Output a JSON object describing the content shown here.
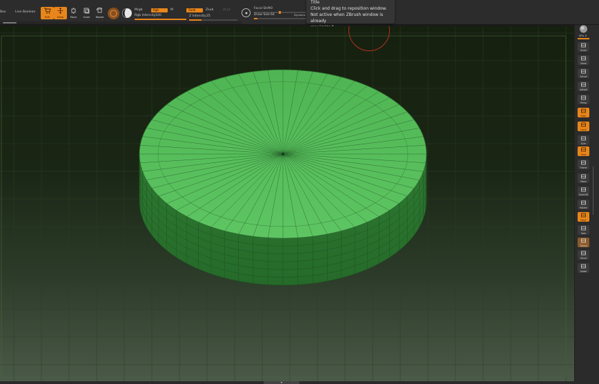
{
  "toolbar": {
    "lightbox_label": "Box",
    "live_boolean_label": "Live Boolean",
    "edit_label": "Edit",
    "draw_label": "Draw",
    "move_label": "Move",
    "scale_label": "Scale",
    "rotate_label": "Rotate",
    "mrgb_label": "Mrgb",
    "rgb_label": "Rgb",
    "m_label": "M",
    "rgb_intensity_label": "Rgb Intensity",
    "rgb_intensity_value": "100",
    "zadd_label": "Zadd",
    "zsub_label": "Zsub",
    "zcut_label": "Zcut",
    "z_intensity_label": "Z Intensity",
    "z_intensity_value": "25",
    "focal_shift_label": "Focal Shift",
    "focal_shift_value": "0",
    "draw_size_label": "Draw Size",
    "draw_size_value": "64",
    "dynamic_label": "Dynamic",
    "rgb_intensity_fraction": 1.0,
    "z_intensity_fraction": 0.25,
    "draw_size_fraction": 0.06,
    "accent_color": "#e9861b"
  },
  "tooltip": {
    "title": "Title",
    "line1": "Click and drag to reposition window.",
    "line2": "Not active when ZBrush window is already",
    "line3": "maximized."
  },
  "shelf": {
    "spix_label": "SPix",
    "spix_value": "0",
    "items": [
      {
        "label": "Scroll",
        "icon": "scroll-icon",
        "state": "off"
      },
      {
        "label": "Zoom",
        "icon": "zoom-icon",
        "state": "off"
      },
      {
        "label": "Actual",
        "icon": "actual-icon",
        "state": "off"
      },
      {
        "label": "AAHalf",
        "icon": "aahalf-icon",
        "state": "off"
      },
      {
        "label": "Persp",
        "icon": "persp-icon",
        "state": "off"
      },
      {
        "label": "Floor",
        "icon": "floor-icon",
        "state": "on"
      },
      {
        "label": "Local",
        "icon": "local-icon",
        "state": "on"
      },
      {
        "label": "Sym",
        "icon": "symmetry-icon",
        "state": "off"
      },
      {
        "label": "Gxyz",
        "icon": "axis-icon",
        "state": "on"
      },
      {
        "label": "Frame",
        "icon": "frame-icon",
        "state": "off"
      },
      {
        "label": "Move",
        "icon": "move-icon",
        "state": "off"
      },
      {
        "label": "Zoom3D",
        "icon": "zoom3d-icon",
        "state": "off"
      },
      {
        "label": "Rotate",
        "icon": "rotate-icon",
        "state": "off"
      },
      {
        "label": "PolyF",
        "icon": "polyframe-icon",
        "state": "on"
      },
      {
        "label": "Solo",
        "icon": "solo-icon",
        "state": "off"
      },
      {
        "label": "Transp",
        "icon": "transp-icon",
        "state": "brown"
      },
      {
        "label": "Ghost",
        "icon": "ghost-icon",
        "state": "off"
      },
      {
        "label": "Xpose",
        "icon": "xpose-icon",
        "state": "off"
      }
    ]
  },
  "canvas": {
    "model_color": "#4caf50",
    "background_top": "#16200f",
    "background_bottom": "#4b5a48"
  }
}
